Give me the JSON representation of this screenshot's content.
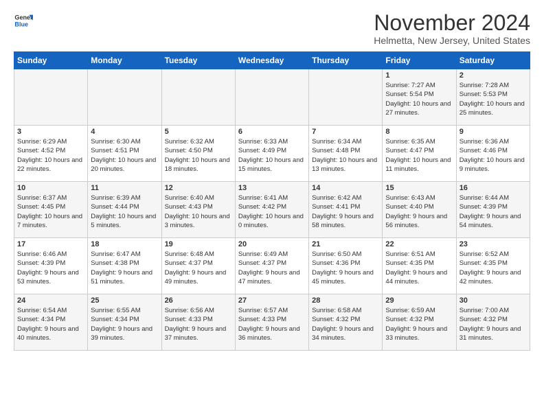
{
  "logo": {
    "line1": "General",
    "line2": "Blue"
  },
  "title": "November 2024",
  "location": "Helmetta, New Jersey, United States",
  "days_header": [
    "Sunday",
    "Monday",
    "Tuesday",
    "Wednesday",
    "Thursday",
    "Friday",
    "Saturday"
  ],
  "weeks": [
    [
      {
        "day": "",
        "info": ""
      },
      {
        "day": "",
        "info": ""
      },
      {
        "day": "",
        "info": ""
      },
      {
        "day": "",
        "info": ""
      },
      {
        "day": "",
        "info": ""
      },
      {
        "day": "1",
        "info": "Sunrise: 7:27 AM\nSunset: 5:54 PM\nDaylight: 10 hours and 27 minutes."
      },
      {
        "day": "2",
        "info": "Sunrise: 7:28 AM\nSunset: 5:53 PM\nDaylight: 10 hours and 25 minutes."
      }
    ],
    [
      {
        "day": "3",
        "info": "Sunrise: 6:29 AM\nSunset: 4:52 PM\nDaylight: 10 hours and 22 minutes."
      },
      {
        "day": "4",
        "info": "Sunrise: 6:30 AM\nSunset: 4:51 PM\nDaylight: 10 hours and 20 minutes."
      },
      {
        "day": "5",
        "info": "Sunrise: 6:32 AM\nSunset: 4:50 PM\nDaylight: 10 hours and 18 minutes."
      },
      {
        "day": "6",
        "info": "Sunrise: 6:33 AM\nSunset: 4:49 PM\nDaylight: 10 hours and 15 minutes."
      },
      {
        "day": "7",
        "info": "Sunrise: 6:34 AM\nSunset: 4:48 PM\nDaylight: 10 hours and 13 minutes."
      },
      {
        "day": "8",
        "info": "Sunrise: 6:35 AM\nSunset: 4:47 PM\nDaylight: 10 hours and 11 minutes."
      },
      {
        "day": "9",
        "info": "Sunrise: 6:36 AM\nSunset: 4:46 PM\nDaylight: 10 hours and 9 minutes."
      }
    ],
    [
      {
        "day": "10",
        "info": "Sunrise: 6:37 AM\nSunset: 4:45 PM\nDaylight: 10 hours and 7 minutes."
      },
      {
        "day": "11",
        "info": "Sunrise: 6:39 AM\nSunset: 4:44 PM\nDaylight: 10 hours and 5 minutes."
      },
      {
        "day": "12",
        "info": "Sunrise: 6:40 AM\nSunset: 4:43 PM\nDaylight: 10 hours and 3 minutes."
      },
      {
        "day": "13",
        "info": "Sunrise: 6:41 AM\nSunset: 4:42 PM\nDaylight: 10 hours and 0 minutes."
      },
      {
        "day": "14",
        "info": "Sunrise: 6:42 AM\nSunset: 4:41 PM\nDaylight: 9 hours and 58 minutes."
      },
      {
        "day": "15",
        "info": "Sunrise: 6:43 AM\nSunset: 4:40 PM\nDaylight: 9 hours and 56 minutes."
      },
      {
        "day": "16",
        "info": "Sunrise: 6:44 AM\nSunset: 4:39 PM\nDaylight: 9 hours and 54 minutes."
      }
    ],
    [
      {
        "day": "17",
        "info": "Sunrise: 6:46 AM\nSunset: 4:39 PM\nDaylight: 9 hours and 53 minutes."
      },
      {
        "day": "18",
        "info": "Sunrise: 6:47 AM\nSunset: 4:38 PM\nDaylight: 9 hours and 51 minutes."
      },
      {
        "day": "19",
        "info": "Sunrise: 6:48 AM\nSunset: 4:37 PM\nDaylight: 9 hours and 49 minutes."
      },
      {
        "day": "20",
        "info": "Sunrise: 6:49 AM\nSunset: 4:37 PM\nDaylight: 9 hours and 47 minutes."
      },
      {
        "day": "21",
        "info": "Sunrise: 6:50 AM\nSunset: 4:36 PM\nDaylight: 9 hours and 45 minutes."
      },
      {
        "day": "22",
        "info": "Sunrise: 6:51 AM\nSunset: 4:35 PM\nDaylight: 9 hours and 44 minutes."
      },
      {
        "day": "23",
        "info": "Sunrise: 6:52 AM\nSunset: 4:35 PM\nDaylight: 9 hours and 42 minutes."
      }
    ],
    [
      {
        "day": "24",
        "info": "Sunrise: 6:54 AM\nSunset: 4:34 PM\nDaylight: 9 hours and 40 minutes."
      },
      {
        "day": "25",
        "info": "Sunrise: 6:55 AM\nSunset: 4:34 PM\nDaylight: 9 hours and 39 minutes."
      },
      {
        "day": "26",
        "info": "Sunrise: 6:56 AM\nSunset: 4:33 PM\nDaylight: 9 hours and 37 minutes."
      },
      {
        "day": "27",
        "info": "Sunrise: 6:57 AM\nSunset: 4:33 PM\nDaylight: 9 hours and 36 minutes."
      },
      {
        "day": "28",
        "info": "Sunrise: 6:58 AM\nSunset: 4:32 PM\nDaylight: 9 hours and 34 minutes."
      },
      {
        "day": "29",
        "info": "Sunrise: 6:59 AM\nSunset: 4:32 PM\nDaylight: 9 hours and 33 minutes."
      },
      {
        "day": "30",
        "info": "Sunrise: 7:00 AM\nSunset: 4:32 PM\nDaylight: 9 hours and 31 minutes."
      }
    ]
  ]
}
